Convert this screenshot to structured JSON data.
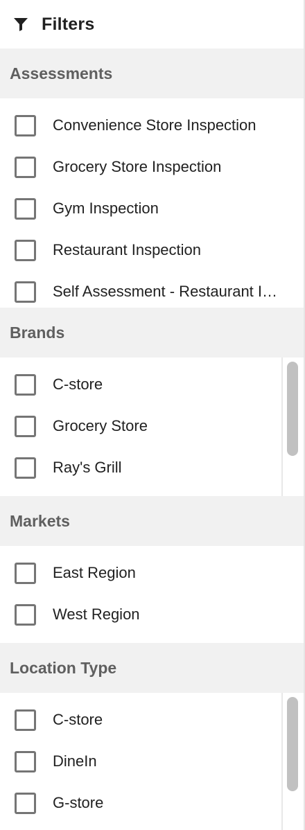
{
  "panel": {
    "title": "Filters",
    "icon": "filter-funnel-icon"
  },
  "sections": [
    {
      "key": "assessments",
      "title": "Assessments",
      "items": [
        "Convenience Store Inspection",
        "Grocery Store Inspection",
        "Gym Inspection",
        "Restaurant Inspection",
        "Self Assessment - Restaurant Inspection"
      ]
    },
    {
      "key": "brands",
      "title": "Brands",
      "items": [
        "C-store",
        "Grocery Store",
        "Ray's Grill"
      ]
    },
    {
      "key": "markets",
      "title": "Markets",
      "items": [
        "East Region",
        "West Region"
      ]
    },
    {
      "key": "location-type",
      "title": "Location Type",
      "items": [
        "C-store",
        "DineIn",
        "G-store"
      ]
    }
  ],
  "colors": {
    "section_header_bg": "#f1f1f1",
    "section_header_text": "#5f5f5f",
    "checkbox_border": "#757575",
    "scrollbar_thumb": "#c1c1c1"
  }
}
